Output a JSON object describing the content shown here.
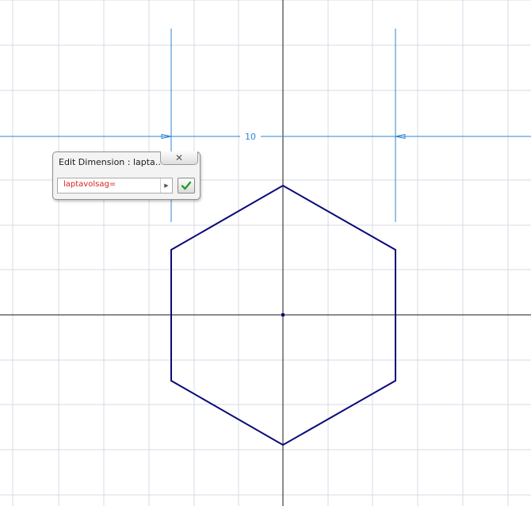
{
  "sketch": {
    "dimension_value": "10",
    "colors": {
      "grid": "#d6dbe3",
      "axis": "#1a1a1a",
      "dimension": "#2f86d6",
      "profile": "#0a0a7a"
    }
  },
  "edit_dimension_dialog": {
    "title": "Edit Dimension : lapta...",
    "close_icon": "close-icon",
    "input_value": "laptavolsag=",
    "input_color": "#d4241c",
    "dropdown_icon": "dropdown-arrow-icon",
    "accept_icon": "checkmark-icon",
    "accept_color": "#2e9a2e"
  }
}
